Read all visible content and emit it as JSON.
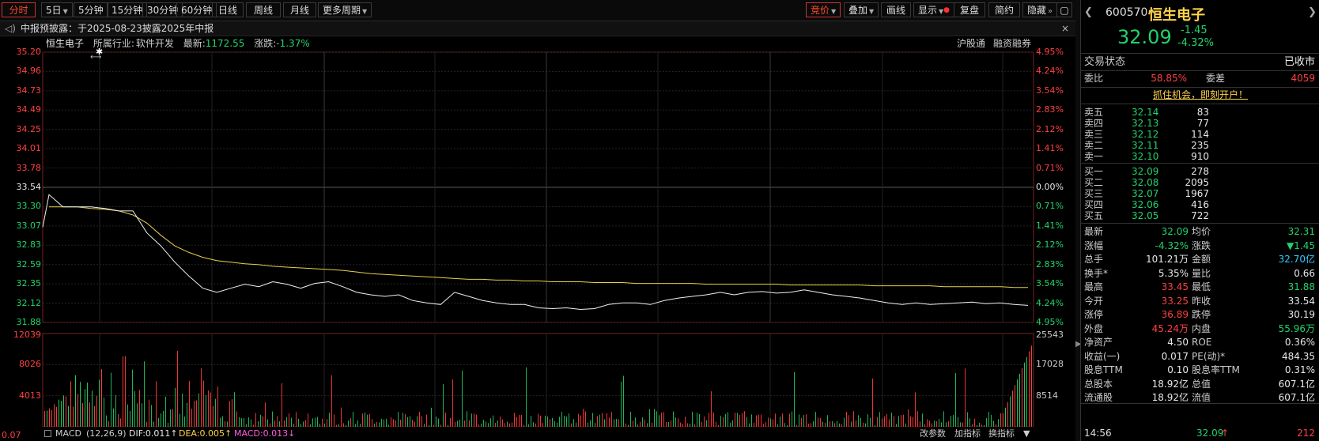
{
  "toolbar": {
    "tabs": [
      "分时",
      "5日",
      "5分钟",
      "15分钟",
      "30分钟",
      "60分钟",
      "日线",
      "周线",
      "月线",
      "更多周期"
    ],
    "right": [
      "竞价",
      "叠加",
      "画线",
      "显示",
      "复盘",
      "简约",
      "隐藏"
    ]
  },
  "notice": {
    "text": "中报预披露：于2025-08-23披露2025年中报",
    "close": "×"
  },
  "chart_info": {
    "name": "恒生电子",
    "industry_label": "所属行业:",
    "industry": "软件开发",
    "latest_label": "最新:",
    "latest": "1172.55",
    "change_label": "涨跌:",
    "change": "-1.37%",
    "hugutong": "沪股通",
    "rzrq": "融资融券"
  },
  "chart_data": {
    "type": "line",
    "price_ticks": [
      "35.20",
      "34.96",
      "34.73",
      "34.49",
      "34.25",
      "34.01",
      "33.78",
      "33.54",
      "33.30",
      "33.07",
      "32.83",
      "32.59",
      "32.35",
      "32.12",
      "31.88"
    ],
    "pct_ticks": [
      "4.95%",
      "4.24%",
      "3.54%",
      "2.83%",
      "2.12%",
      "1.41%",
      "0.71%",
      "0.00%",
      "0.71%",
      "1.41%",
      "2.12%",
      "2.83%",
      "3.54%",
      "4.24%",
      "4.95%"
    ],
    "ylim": [
      31.88,
      35.2
    ],
    "prev_close": 33.54,
    "series": [
      {
        "values": [
          33.45,
          33.3,
          33.3,
          33.3,
          33.28,
          33.25,
          33.25,
          32.98,
          32.82,
          32.62,
          32.45,
          32.3,
          32.25,
          32.3,
          32.35,
          32.32,
          32.38,
          32.35,
          32.3,
          32.36,
          32.38,
          32.32,
          32.25,
          32.22,
          32.2,
          32.22,
          32.15,
          32.12,
          32.1,
          32.25,
          32.2,
          32.15,
          32.12,
          32.1,
          32.1,
          32.06,
          32.05,
          32.06,
          32.04,
          32.05,
          32.1,
          32.12,
          32.12,
          32.1,
          32.15,
          32.18,
          32.2,
          32.22,
          32.25,
          32.22,
          32.25,
          32.26,
          32.24,
          32.25,
          32.28,
          32.25,
          32.22,
          32.2,
          32.18,
          32.15,
          32.12,
          32.1,
          32.12,
          32.1,
          32.11,
          32.12,
          32.13,
          32.11,
          32.12,
          32.1,
          32.09
        ]
      },
      {
        "values": [
          33.3,
          33.3,
          33.3,
          33.28,
          33.27,
          33.25,
          33.2,
          33.1,
          32.95,
          32.82,
          32.74,
          32.68,
          32.64,
          32.62,
          32.6,
          32.59,
          32.57,
          32.56,
          32.55,
          32.54,
          32.53,
          32.52,
          32.5,
          32.48,
          32.47,
          32.46,
          32.45,
          32.44,
          32.43,
          32.42,
          32.41,
          32.41,
          32.4,
          32.4,
          32.39,
          32.39,
          32.38,
          32.38,
          32.38,
          32.37,
          32.37,
          32.37,
          32.36,
          32.36,
          32.36,
          32.36,
          32.36,
          32.35,
          32.35,
          32.35,
          32.35,
          32.35,
          32.35,
          32.34,
          32.34,
          32.34,
          32.34,
          32.34,
          32.34,
          32.33,
          32.33,
          32.33,
          32.33,
          32.33,
          32.32,
          32.32,
          32.32,
          32.32,
          32.32,
          32.31,
          32.31
        ]
      }
    ],
    "vol_ticks_left": [
      "12039",
      "8026",
      "4013",
      "0.07"
    ],
    "vol_ticks_right": [
      "25543",
      "17028",
      "8514"
    ]
  },
  "macd": {
    "label": "MACD",
    "params": "(12,26,9)",
    "dif": "DIF:0.011↑",
    "dea": "DEA:0.005↑",
    "macd": "MACD:0.013↓",
    "buttons": [
      "改参数",
      "加指标",
      "换指标"
    ]
  },
  "panel": {
    "code": "600570",
    "name": "恒生电子",
    "price": "32.09",
    "change": "-1.45",
    "change_pct": "-4.32%",
    "status_label": "交易状态",
    "status": "已收市",
    "ratio_label": "委比",
    "ratio": "58.85%",
    "diff_label": "委差",
    "diff": "4059",
    "promo": "抓住机会，即刻开户！",
    "asks": [
      [
        "卖五",
        "32.14",
        "83"
      ],
      [
        "卖四",
        "32.13",
        "77"
      ],
      [
        "卖三",
        "32.12",
        "114"
      ],
      [
        "卖二",
        "32.11",
        "235"
      ],
      [
        "卖一",
        "32.10",
        "910"
      ]
    ],
    "bids": [
      [
        "买一",
        "32.09",
        "278"
      ],
      [
        "买二",
        "32.08",
        "2095"
      ],
      [
        "买三",
        "32.07",
        "1967"
      ],
      [
        "买四",
        "32.06",
        "416"
      ],
      [
        "买五",
        "32.05",
        "722"
      ]
    ],
    "stats": [
      [
        "最新",
        "32.09",
        "均价",
        "32.31"
      ],
      [
        "涨幅",
        "-4.32%",
        "涨跌",
        "▼1.45"
      ],
      [
        "总手",
        "101.21万",
        "金额",
        "32.70亿"
      ],
      [
        "换手*",
        "5.35%",
        "量比",
        "0.66"
      ],
      [
        "最高",
        "33.45",
        "最低",
        "31.88"
      ],
      [
        "今开",
        "33.25",
        "昨收",
        "33.54"
      ],
      [
        "涨停",
        "36.89",
        "跌停",
        "30.19"
      ],
      [
        "外盘",
        "45.24万",
        "内盘",
        "55.96万"
      ],
      [
        "净资产",
        "4.50",
        "ROE",
        "0.36%"
      ],
      [
        "收益(一)",
        "0.017",
        "PE(动)*",
        "484.35"
      ],
      [
        "股息TTM",
        "0.10",
        "股息率TTM",
        "0.31%"
      ],
      [
        "总股本",
        "18.92亿",
        "总值",
        "607.1亿"
      ],
      [
        "流通股",
        "18.92亿",
        "流值",
        "607.1亿"
      ]
    ],
    "tick_time": "14:56",
    "tick_price": "32.09",
    "tick_vol": "212"
  }
}
